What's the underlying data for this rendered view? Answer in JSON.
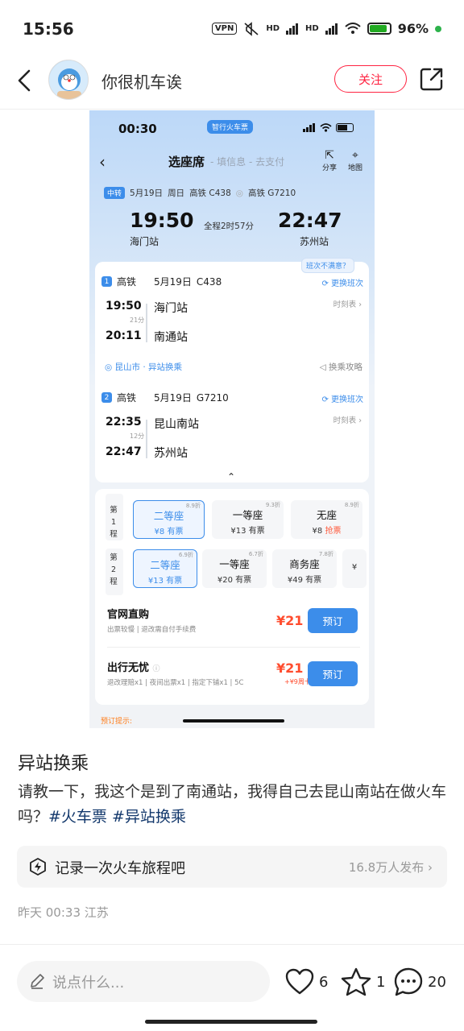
{
  "status_bar": {
    "time": "15:56",
    "vpn": "VPN",
    "hd1": "HD",
    "hd2": "HD",
    "battery": "96%"
  },
  "header": {
    "author": "你很机车诶",
    "follow_label": "关注"
  },
  "screenshot": {
    "time": "00:30",
    "brand": "智行火车票",
    "steps": {
      "current": "选座席",
      "rest": "- 填信息 - 去支付"
    },
    "tools": {
      "share": "分享",
      "map": "地图"
    },
    "trip": {
      "tag": "中转",
      "date": "5月19日",
      "weekday": "周日",
      "train1": "高铁 C438",
      "train2": "高铁 G7210"
    },
    "depart": {
      "time": "19:50",
      "station": "海门站"
    },
    "arrive": {
      "time": "22:47",
      "station": "苏州站"
    },
    "duration": "全程2时57分",
    "dissatisfied": "班次不满意？",
    "segments": [
      {
        "num": "1",
        "type": "高铁",
        "date": "5月19日",
        "train": "C438",
        "change": "更换班次",
        "dep_time": "19:50",
        "dep_station": "海门站",
        "dur": "21分",
        "arr_time": "20:11",
        "arr_station": "南通站",
        "timetable": "时刻表 ›"
      },
      {
        "num": "2",
        "type": "高铁",
        "date": "5月19日",
        "train": "G7210",
        "change": "更换班次",
        "dep_time": "22:35",
        "dep_station": "昆山南站",
        "dur": "12分",
        "arr_time": "22:47",
        "arr_station": "苏州站",
        "timetable": "时刻表 ›"
      }
    ],
    "transfer": {
      "city": "昆山市 · 异站换乘",
      "guide": "换乘攻略"
    },
    "leg_labels": [
      "第\n1\n程",
      "第\n2\n程"
    ],
    "seats_leg1": [
      {
        "name": "二等座",
        "price": "¥8 有票",
        "disc": "8.9折",
        "selected": true
      },
      {
        "name": "一等座",
        "price": "¥13 有票",
        "disc": "9.3折"
      },
      {
        "name": "无座",
        "price_prefix": "¥8 ",
        "price_red": "抢票",
        "disc": "8.9折"
      }
    ],
    "seats_leg2": [
      {
        "name": "二等座",
        "price": "¥13 有票",
        "disc": "6.9折",
        "selected": true
      },
      {
        "name": "一等座",
        "price": "¥20 有票",
        "disc": "6.7折"
      },
      {
        "name": "商务座",
        "price": "¥49 有票",
        "disc": "7.8折"
      },
      {
        "name": "",
        "price": "¥"
      }
    ],
    "purchase": [
      {
        "title": "官网直购",
        "sub": "出票较慢 | 退改需自付手续费",
        "price": "¥21",
        "btn": "预订"
      },
      {
        "title": "出行无忧",
        "sub": "退改理赔x1 | 夜间出票x1 | 指定下铺x1 | 5C",
        "price": "¥21",
        "note": "+¥9周卡",
        "btn": "预订"
      }
    ],
    "tip": "预订提示:"
  },
  "post": {
    "title": "异站换乘",
    "body": "请教一下，我这个是到了南通站，我得自己去昆山南站在做火车吗？",
    "tag1": "#火车票",
    "tag2": "#异站换乘"
  },
  "record": {
    "text": "记录一次火车旅程吧",
    "count": "16.8万人发布 ›"
  },
  "meta": "昨天 00:33 江苏",
  "bottom": {
    "placeholder": "说点什么...",
    "likes": "6",
    "stars": "1",
    "comments": "20"
  }
}
